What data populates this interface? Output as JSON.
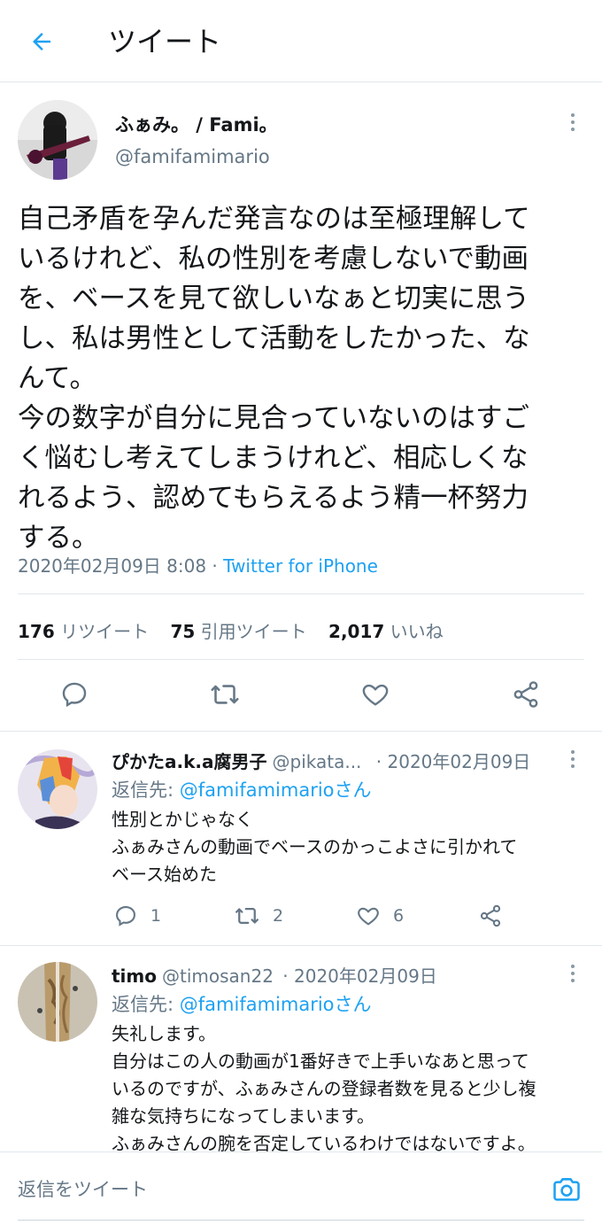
{
  "header": {
    "title": "ツイート",
    "back_icon": "arrow-left-icon"
  },
  "accent_color": "#1da1f2",
  "main_tweet": {
    "name": "ふぁみ。 / Fami。",
    "handle": "@famifamimario",
    "lines": [
      "自己矛盾を孕んだ発言なのは至極理解して",
      "いるけれど、私の性別を考慮しないで動画",
      "を、ベースを見て欲しいなぁと切実に思う",
      "し、私は男性として活動をしたかった、な",
      "んて。",
      "今の数字が自分に見合っていないのはすご",
      "く悩むし考えてしまうけれど、相応しくな",
      "れるよう、認めてもらえるよう精一杯努力",
      "する。"
    ],
    "timestamp": "2020年02月09日 8:08",
    "separator": " · ",
    "source": "Twitter for iPhone",
    "stats": {
      "retweets_count": "176",
      "retweets_label": "リツイート",
      "quotes_count": "75",
      "quotes_label": "引用ツイート",
      "likes_count": "2,017",
      "likes_label": "いいね"
    }
  },
  "replies": [
    {
      "name": "ぴかたa.k.a腐男子",
      "handle": "@pikata...",
      "date": "· 2020年02月09日",
      "reply_to_prefix": "返信先: ",
      "reply_to_link": "@famifamimarioさん",
      "lines": [
        "性別とかじゃなく",
        "ふぁみさんの動画でベースのかっこよさに引かれて",
        "ベース始めた"
      ],
      "reply_count": "1",
      "retweet_count": "2",
      "like_count": "6"
    },
    {
      "name": "timo",
      "handle": "@timosan22",
      "date": "· 2020年02月09日",
      "reply_to_prefix": "返信先: ",
      "reply_to_link": "@famifamimarioさん",
      "lines": [
        "失礼します。",
        "自分はこの人の動画が1番好きで上手いなあと思って",
        "いるのですが、ふぁみさんの登録者数を見ると少し複",
        "雑な気持ちになってしまいます。",
        "ふぁみさんの腕を否定しているわけではないですよ。"
      ]
    }
  ],
  "composer": {
    "placeholder": "返信をツイート",
    "camera_icon": "camera-icon"
  }
}
